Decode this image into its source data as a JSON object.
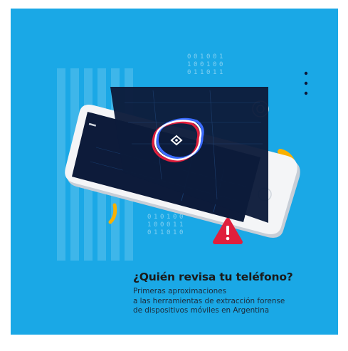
{
  "colors": {
    "background": "#1aa8e6",
    "dark_navy": "#0d1b3a",
    "accent_yellow": "#f9b000",
    "alert_red": "#e01f3d",
    "phone_frame": "#f4f5f7"
  },
  "cover": {
    "title": "¿Quién revisa tu teléfono?",
    "subtitle_lines": [
      "Primeras aproximaciones",
      "a las herramientas de extracción forense",
      "de dispositivos móviles en Argentina"
    ]
  },
  "icons": [
    "shield-icon",
    "warning-icon"
  ],
  "binary_digits": [
    "0",
    "0",
    "1",
    "0",
    "0",
    "1",
    "1",
    "0",
    "0",
    "1",
    "0",
    "0",
    "0",
    "1",
    "1",
    "0",
    "1",
    "1",
    "0",
    "1",
    "0",
    "1",
    "0",
    "0",
    "1",
    "0",
    "0",
    "0",
    "1",
    "1",
    "0",
    "1",
    "1",
    "0",
    "1",
    "0"
  ]
}
